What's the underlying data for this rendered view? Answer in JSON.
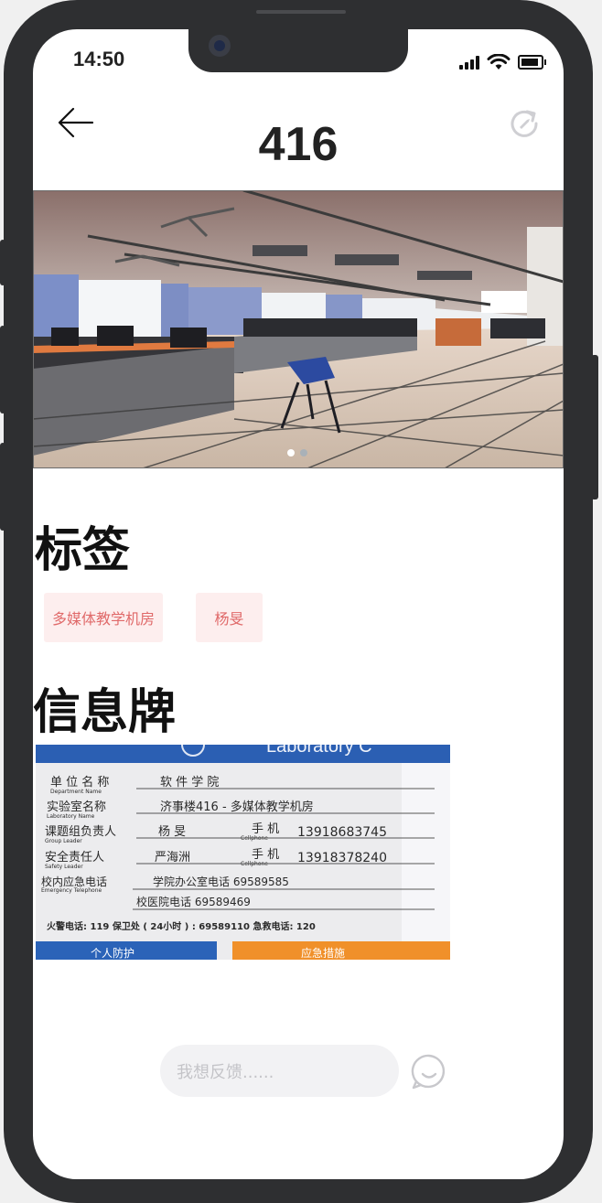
{
  "status": {
    "time": "14:50"
  },
  "header": {
    "title": "416",
    "back_icon": "arrow-left-icon",
    "refresh_icon": "refresh-icon"
  },
  "carousel": {
    "slide_count": 2,
    "active_slide": 1
  },
  "tags_section": {
    "heading": "标签",
    "tags": [
      "多媒体教学机房",
      "杨旻"
    ]
  },
  "info_section": {
    "heading": "信息牌",
    "sign": {
      "header_text": "Laboratory C",
      "rows": [
        {
          "label": "单 位 名 称",
          "sub": "Department Name",
          "value": "软 件 学 院"
        },
        {
          "label": "实验室名称",
          "sub": "Laboratory Name",
          "value": "济事楼416 - 多媒体教学机房"
        },
        {
          "label": "课题组负责人",
          "sub": "Group Leader",
          "value": "杨 旻",
          "phone_label": "手 机",
          "phone_sub": "Cellphone",
          "phone": "13918683745"
        },
        {
          "label": "安全责任人",
          "sub": "Safety Leader",
          "value": "严海洲",
          "phone_label": "手 机",
          "phone_sub": "Cellphone",
          "phone": "13918378240"
        },
        {
          "label": "校内应急电话",
          "sub": "Emergency Telephone",
          "value": "学院办公室电话  69589585"
        },
        {
          "label": "",
          "sub": "",
          "value": "校医院电话  69589469"
        }
      ],
      "emergency_line": "火警电话: 119   保卫处 ( 24小时 ) : 69589110   急救电话: 120",
      "footer_left": "个人防护",
      "footer_right": "应急措施"
    }
  },
  "feedback": {
    "placeholder": "我想反馈......",
    "chat_icon": "chat-bubble-icon"
  },
  "colors": {
    "tag_bg": "#fdeeee",
    "tag_text": "#e06a6a",
    "sign_blue": "#2b5fb3",
    "sign_orange": "#f0902a"
  }
}
